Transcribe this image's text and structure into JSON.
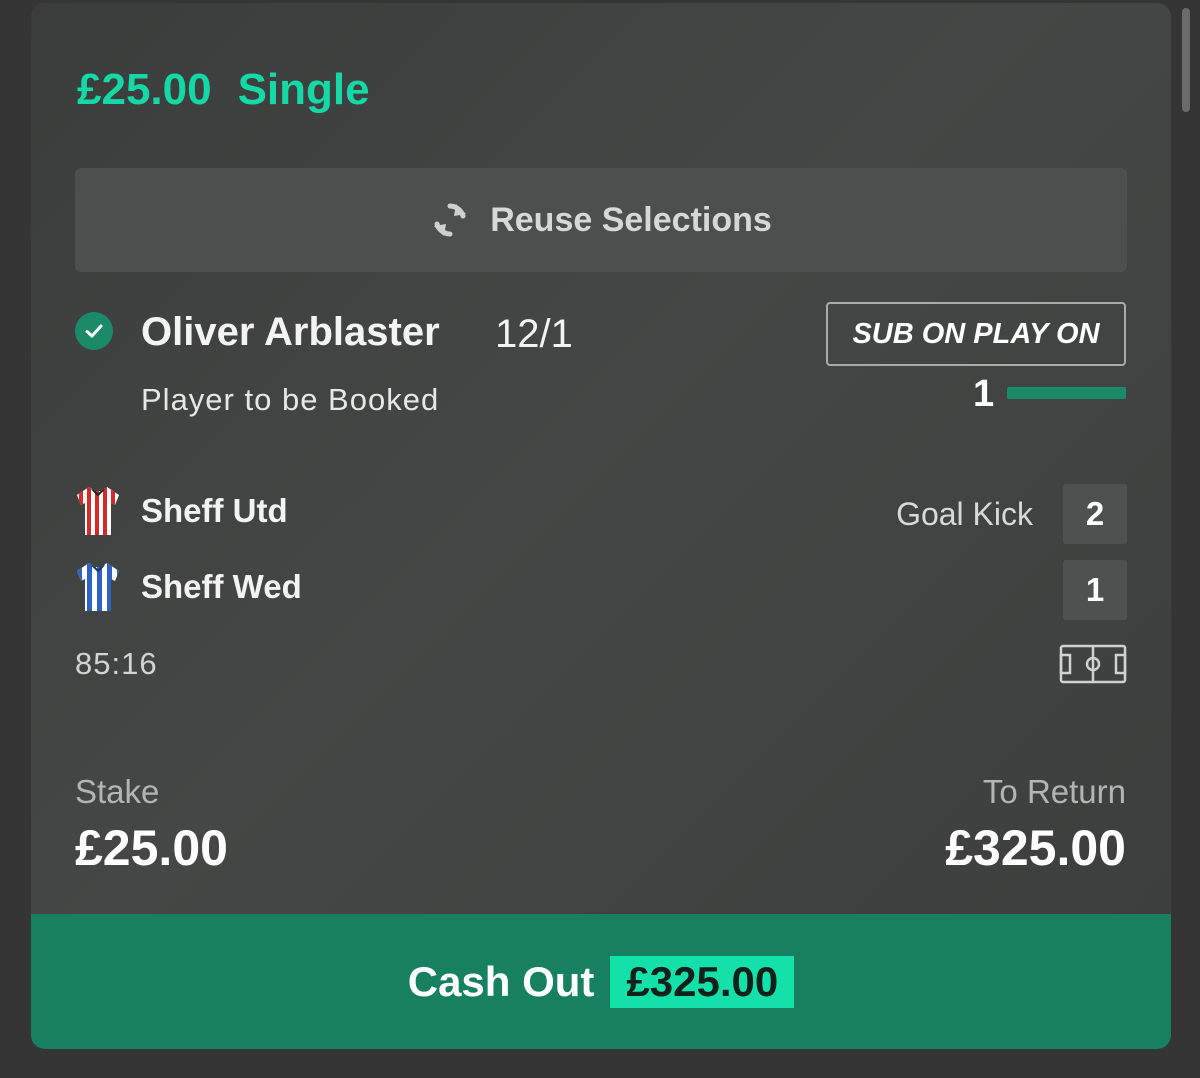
{
  "bet": {
    "stake_amount": "£25.00",
    "bet_type": "Single"
  },
  "reuse": {
    "label": "Reuse Selections",
    "icon": "refresh-icon"
  },
  "selection": {
    "name": "Oliver Arblaster",
    "odds": "12/1",
    "market": "Player to be Booked",
    "status_icon": "check-circle-icon",
    "badge": "SUB ON PLAY ON",
    "progress_count": "1"
  },
  "match": {
    "home_team": "Sheff Utd",
    "away_team": "Sheff Wed",
    "home_score": "2",
    "away_score": "1",
    "event": "Goal Kick",
    "clock": "85:16",
    "pitch_icon": "pitch-icon"
  },
  "summary": {
    "stake_label": "Stake",
    "stake_value": "£25.00",
    "return_label": "To Return",
    "return_value": "£325.00"
  },
  "cashout": {
    "label": "Cash Out",
    "amount": "£325.00"
  },
  "colors": {
    "accent": "#14d9a6",
    "cashout_bg": "#168060",
    "cashout_amount_bg": "#14e0a9",
    "card_bg": "#414442"
  }
}
